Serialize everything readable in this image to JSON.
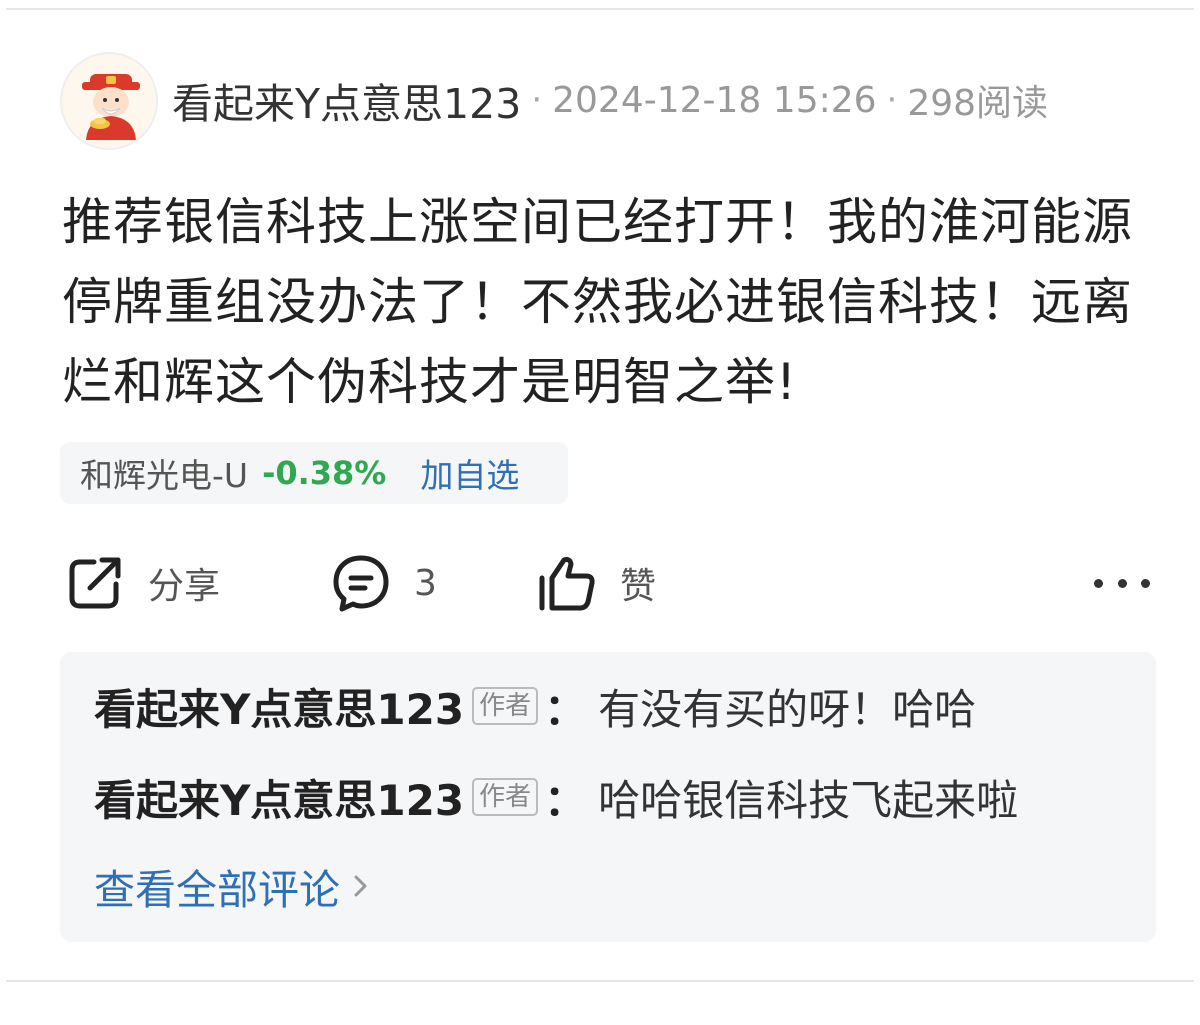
{
  "post": {
    "author": "看起来Y点意思123",
    "separator": "·",
    "datetime": "2024-12-18 15:26",
    "reads": "298阅读",
    "content": "推荐银信科技上涨空间已经打开！我的淮河能源停牌重组没办法了！不然我必进银信科技！远离烂和辉这个伪科技才是明智之举!",
    "stock": {
      "name": "和辉光电-U",
      "change": "-0.38%",
      "add_watch": "加自选",
      "change_color": "#2fa84f"
    }
  },
  "actions": {
    "share": "分享",
    "comment_count": "3",
    "like": "赞"
  },
  "comments": {
    "items": [
      {
        "author": "看起来Y点意思123",
        "badge": "作者",
        "colon": "：",
        "text": "有没有买的呀！哈哈"
      },
      {
        "author": "看起来Y点意思123",
        "badge": "作者",
        "colon": "：",
        "text": "哈哈银信科技飞起来啦"
      }
    ],
    "view_all": "查看全部评论"
  },
  "icons": {
    "avatar": "caishen-avatar",
    "share": "share-icon",
    "comment": "comment-icon",
    "like": "thumbs-up-icon",
    "more": "more-dots-icon",
    "chevron": "chevron-right-icon"
  },
  "colors": {
    "link_blue": "#2f6fb5",
    "down_green": "#2fa84f"
  }
}
